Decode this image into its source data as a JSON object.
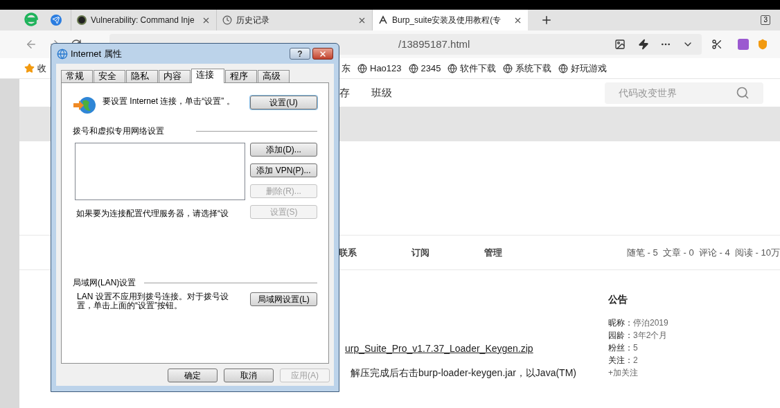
{
  "browser": {
    "tabs": [
      {
        "title": "Vulnerability: Command Inje",
        "selected": false,
        "kind": "target"
      },
      {
        "title": "历史记录",
        "selected": false,
        "kind": "history"
      },
      {
        "title": "Burp_suite安装及使用教程(专",
        "selected": true,
        "kind": "site"
      }
    ],
    "tab_count": "3",
    "address": "/13895187.html",
    "bookmarks": [
      "东",
      "Hao123",
      "2345",
      "软件下载",
      "系统下载",
      "好玩游戏"
    ],
    "favorites": "收"
  },
  "site": {
    "nav": [
      "存",
      "班级"
    ],
    "search": {
      "placeholder": "代码改变世界"
    },
    "blog_nav": [
      "联系",
      "订阅",
      "管理"
    ],
    "stats": "随笔 - 5  文章 - 0  评论 - 4  阅读 - 10万",
    "link": "urp_Suite_Pro_v1.7.37_Loader_Keygen.zip",
    "paragraph": "解压完成后右击burp-loader-keygen.jar，以Java(TM)",
    "notice": {
      "title": "公告",
      "rows": [
        {
          "label": "昵称：",
          "value": "停泊2019"
        },
        {
          "label": "园龄：",
          "value": "3年2个月"
        },
        {
          "label": "粉丝：",
          "value": "5"
        },
        {
          "label": "关注：",
          "value": "2"
        }
      ],
      "follow": "+加关注"
    }
  },
  "dialog": {
    "title": "Internet 属性",
    "help": "?",
    "tabs": [
      {
        "label": "常规",
        "selected": false
      },
      {
        "label": "安全",
        "selected": false
      },
      {
        "label": "隐私",
        "selected": false
      },
      {
        "label": "内容",
        "selected": false
      },
      {
        "label": "连接",
        "selected": true
      },
      {
        "label": "程序",
        "selected": false
      },
      {
        "label": "高级",
        "selected": false
      }
    ],
    "intro": "要设置 Internet 连接，单击“设置” 。",
    "setup_button": {
      "label": "设置(U)",
      "disabled": false
    },
    "vpn_section": "拨号和虚拟专用网络设置",
    "vpn_buttons": [
      {
        "label": "添加(D)...",
        "disabled": false
      },
      {
        "label": "添加 VPN(P)...",
        "disabled": false
      },
      {
        "label": "删除(R)...",
        "disabled": true
      },
      {
        "label": "设置(S)",
        "disabled": true
      }
    ],
    "proxy_text": "如果要为连接配置代理服务器，请选择“设",
    "lan_section": "局域网(LAN)设置",
    "lan_text": "LAN 设置不应用到拨号连接。对于拨号设置，单击上面的“设置”按钮。",
    "lan_button": {
      "label": "局域网设置(L)",
      "disabled": false
    },
    "footer_buttons": [
      {
        "label": "确定",
        "disabled": false
      },
      {
        "label": "取消",
        "disabled": false
      },
      {
        "label": "应用(A)",
        "disabled": true
      }
    ]
  }
}
